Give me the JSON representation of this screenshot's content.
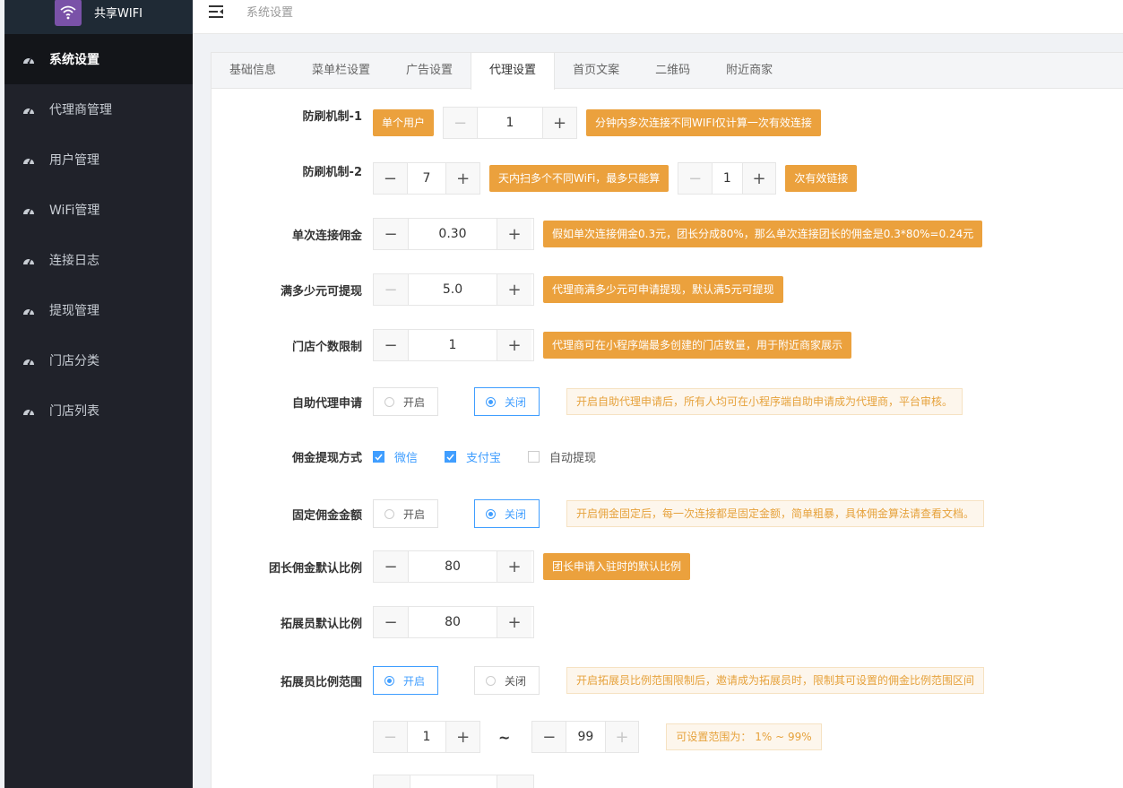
{
  "app": {
    "title": "共享WIFI"
  },
  "breadcrumb": "系统设置",
  "sidebar": {
    "items": [
      {
        "label": "系统设置",
        "active": true
      },
      {
        "label": "代理商管理"
      },
      {
        "label": "用户管理"
      },
      {
        "label": "WiFi管理"
      },
      {
        "label": "连接日志"
      },
      {
        "label": "提现管理"
      },
      {
        "label": "门店分类"
      },
      {
        "label": "门店列表"
      }
    ]
  },
  "tabs": [
    "基础信息",
    "菜单栏设置",
    "广告设置",
    "代理设置",
    "首页文案",
    "二维码",
    "附近商家"
  ],
  "active_tab": "代理设置",
  "form": {
    "anti_brush_1": {
      "label": "防刷机制-1",
      "prefix": "单个用户",
      "value": "1",
      "tip": "分钟内多次连接不同WIFI仅计算一次有效连接"
    },
    "anti_brush_2": {
      "label": "防刷机制-2",
      "value": "7",
      "tip1": "天内扫多个不同WiFi，最多只能算",
      "value2": "1",
      "tip2": "次有效链接"
    },
    "commission": {
      "label": "单次连接佣金",
      "value": "0.30",
      "tip": "假如单次连接佣金0.3元，团长分成80%，那么单次连接团长的佣金是0.3*80%=0.24元"
    },
    "withdraw_min": {
      "label": "满多少元可提现",
      "value": "5.0",
      "tip": "代理商满多少元可申请提现，默认满5元可提现"
    },
    "store_limit": {
      "label": "门店个数限制",
      "value": "1",
      "tip": "代理商可在小程序端最多创建的门店数量，用于附近商家展示"
    },
    "self_apply": {
      "label": "自助代理申请",
      "on": "开启",
      "off": "关闭",
      "selected": "off",
      "note": "开启自助代理申请后，所有人均可在小程序端自助申请成为代理商，平台审核。"
    },
    "withdraw_method": {
      "label": "佣金提现方式",
      "options": [
        {
          "label": "微信",
          "checked": true
        },
        {
          "label": "支付宝",
          "checked": true
        },
        {
          "label": "自动提现",
          "checked": false
        }
      ]
    },
    "fixed_commission": {
      "label": "固定佣金金额",
      "on": "开启",
      "off": "关闭",
      "selected": "off",
      "note": "开启佣金固定后，每一次连接都是固定金额，简单粗暴，具体佣金算法请查看文档。"
    },
    "leader_ratio": {
      "label": "团长佣金默认比例",
      "value": "80",
      "tip": "团长申请入驻时的默认比例"
    },
    "promoter_ratio": {
      "label": "拓展员默认比例",
      "value": "80"
    },
    "promoter_range": {
      "label": "拓展员比例范围",
      "on": "开启",
      "off": "关闭",
      "selected": "on",
      "note": "开启拓展员比例范围限制后，邀请成为拓展员时，限制其可设置的佣金比例范围区间",
      "min": "1",
      "tilde": "~",
      "max": "99",
      "range_note": "可设置范围为： 1% ~ 99%"
    }
  }
}
